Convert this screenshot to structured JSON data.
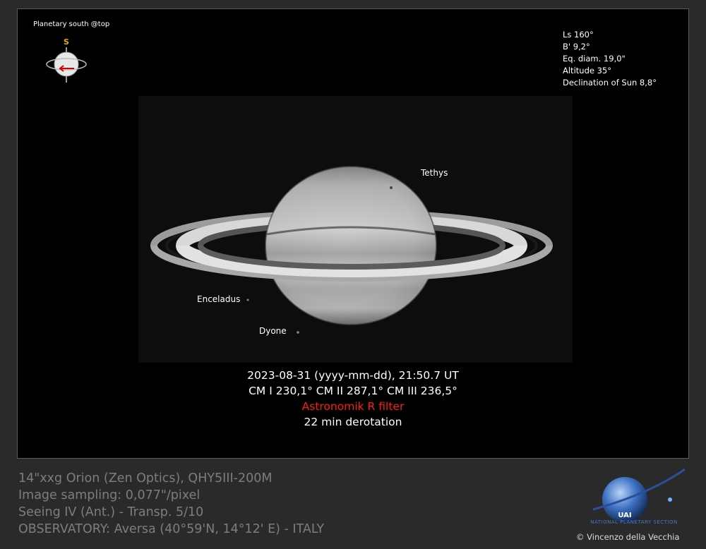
{
  "orientation": {
    "caption": "Planetary south @top",
    "pole_letter": "S"
  },
  "parameters": [
    "Ls 160°",
    "B' 9,2°",
    "Eq. diam. 19,0\"",
    "Altitude 35°",
    "Declination of Sun 8,8°"
  ],
  "moons": {
    "tethys": "Tethys",
    "enceladus": "Enceladus",
    "dione": "Dyone"
  },
  "caption": {
    "datetime": "2023-08-31 (yyyy-mm-dd), 21:50.7 UT",
    "central_meridians": "CM I 230,1° CM II 287,1° CM III 236,5°",
    "filter": "Astronomik R filter",
    "derotation": "22 min derotation"
  },
  "equipment": {
    "telescope": "14\"xxg Orion (Zen Optics), QHY5III-200M",
    "sampling": "Image sampling: 0,077\"/pixel",
    "seeing": "Seeing IV (Ant.) - Transp. 5/10",
    "observatory": "OBSERVATORY: Aversa (40°59'N, 14°12' E) - ITALY"
  },
  "logo": {
    "name": "UAI",
    "subtitle": "NATIONAL PLANETARY SECTION"
  },
  "copyright": "© Vincenzo  della Vecchia",
  "colors": {
    "filter_text": "#ff1a1a",
    "background": "#000000",
    "outer_background": "#2a2a2a",
    "logo_blue": "#4a78c8"
  }
}
